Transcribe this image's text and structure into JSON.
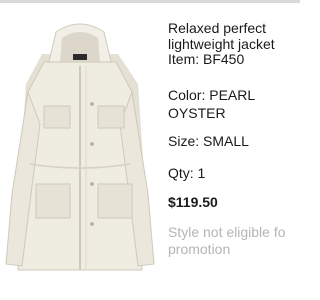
{
  "product": {
    "title_line1": "Relaxed perfect",
    "title_line2": "lightweight jacket",
    "item": "Item: BF450",
    "color_line1": "Color: PEARL",
    "color_line2": "OYSTER",
    "size": "Size: SMALL",
    "qty": "Qty: 1",
    "price": "$119.50",
    "promo_line1": "Style not eligible fo",
    "promo_line2": "promotion"
  },
  "colors": {
    "jacket": "#efece2",
    "jacket_shadow": "#d9d4c6",
    "text": "#1a1a1a",
    "muted": "#b5b5b5"
  },
  "image": {
    "icon": "jacket-product-image"
  }
}
